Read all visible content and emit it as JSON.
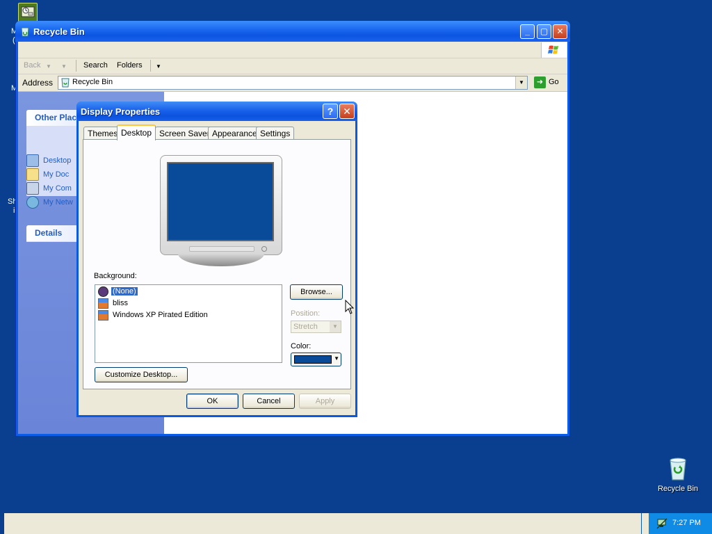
{
  "desktop": {
    "left_fragments": [
      "M",
      "(",
      "M",
      "Sh",
      "i"
    ],
    "recycle_bin_label": "Recycle Bin"
  },
  "explorer": {
    "title": "Recycle Bin",
    "toolbar": {
      "back": "Back",
      "search": "Search",
      "folders": "Folders"
    },
    "address": {
      "label": "Address",
      "value": "Recycle Bin",
      "go": "Go"
    },
    "left_pane": {
      "other_places_title": "Other Plac",
      "items": [
        "Desktop",
        "My Doc",
        "My Com",
        "My Netw"
      ],
      "details_title": "Details"
    }
  },
  "dialog": {
    "title": "Display Properties",
    "help_glyph": "?",
    "tabs": [
      "Themes",
      "Desktop",
      "Screen Saver",
      "Appearance",
      "Settings"
    ],
    "active_tab": "Desktop",
    "background_label": "Background:",
    "backgrounds": [
      {
        "label": "(None)",
        "selected": true
      },
      {
        "label": "bliss",
        "selected": false
      },
      {
        "label": "Windows XP Pirated Edition",
        "selected": false
      }
    ],
    "browse_button": "Browse...",
    "position_label": "Position:",
    "position_value": "Stretch",
    "color_label": "Color:",
    "color_value": "#0a4b99",
    "customize_button": "Customize Desktop...",
    "ok_button": "OK",
    "cancel_button": "Cancel",
    "apply_button": "Apply"
  },
  "taskbar": {
    "clock": "7:27 PM"
  },
  "colors": {
    "desktop": "#0a3e8f",
    "title_blue": "#0b5ce6",
    "tray": "#0f8be6",
    "selection": "#316ac5"
  }
}
